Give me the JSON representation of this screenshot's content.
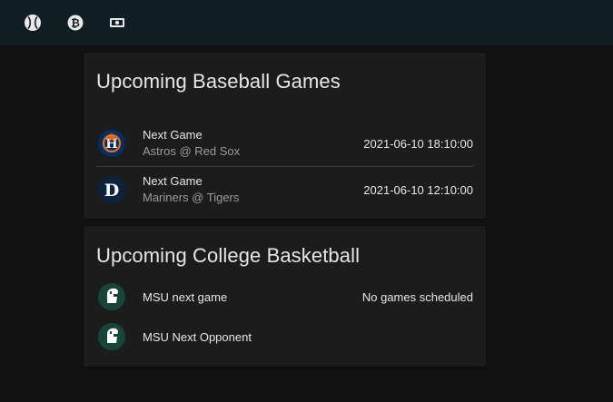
{
  "toolbar": {
    "tabs": [
      {
        "icon": "baseball-icon"
      },
      {
        "icon": "bitcoin-icon"
      },
      {
        "icon": "cash-icon"
      }
    ]
  },
  "baseball": {
    "title": "Upcoming Baseball Games",
    "games": [
      {
        "label": "Next Game",
        "matchup": "Astros @ Red Sox",
        "time": "2021-06-10 18:10:00",
        "logo": "astros-logo"
      },
      {
        "label": "Next Game",
        "matchup": "Mariners @ Tigers",
        "time": "2021-06-10 12:10:00",
        "logo": "tigers-logo"
      }
    ]
  },
  "basketball": {
    "title": "Upcoming College Basketball",
    "items": [
      {
        "label": "MSU next game",
        "state": "No games scheduled",
        "logo": "spartan-logo"
      },
      {
        "label": "MSU Next Opponent",
        "state": "",
        "logo": "spartan-logo"
      }
    ]
  },
  "colors": {
    "topbar": "#101e24",
    "background": "#111111",
    "card": "#1c1c1c",
    "astros_navy": "#002d62",
    "astros_orange": "#eb6e1f",
    "tigers_navy": "#0c2340",
    "spartan_green": "#18453b"
  }
}
